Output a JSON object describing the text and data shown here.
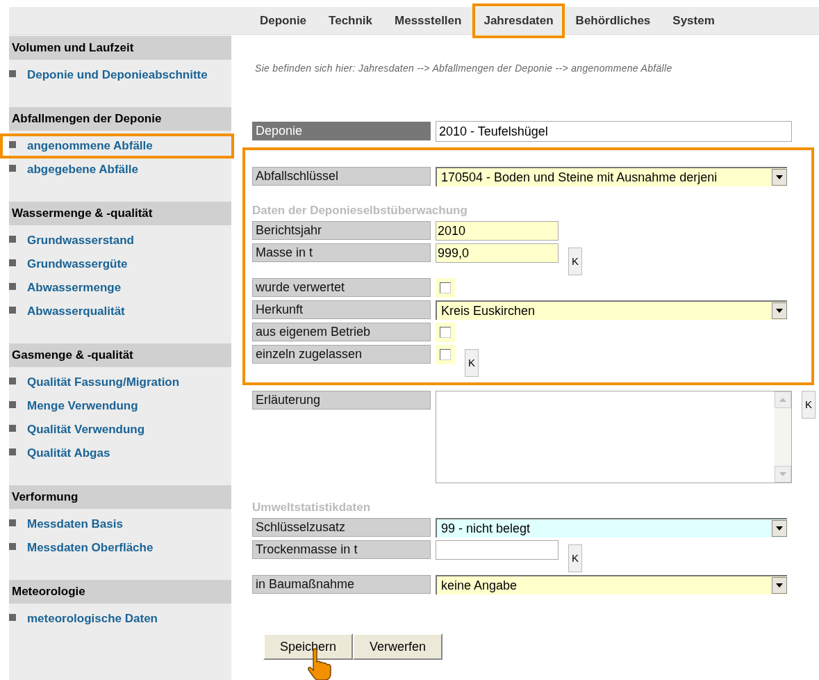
{
  "nav": {
    "tabs": [
      {
        "label": "Deponie",
        "selected": false
      },
      {
        "label": "Technik",
        "selected": false
      },
      {
        "label": "Messstellen",
        "selected": false
      },
      {
        "label": "Jahresdaten",
        "selected": true
      },
      {
        "label": "Behördliches",
        "selected": false
      },
      {
        "label": "System",
        "selected": false
      }
    ]
  },
  "sidebar": {
    "sections": [
      {
        "title": "Volumen und Laufzeit",
        "items": [
          {
            "label": "Deponie und Deponieabschnitte",
            "selected": false
          }
        ]
      },
      {
        "title": "Abfallmengen der Deponie",
        "items": [
          {
            "label": "angenommene Abfälle",
            "selected": true
          },
          {
            "label": "abgegebene Abfälle",
            "selected": false
          }
        ]
      },
      {
        "title": "Wassermenge & -qualität",
        "items": [
          {
            "label": "Grundwasserstand",
            "selected": false
          },
          {
            "label": "Grundwassergüte",
            "selected": false
          },
          {
            "label": "Abwassermenge",
            "selected": false
          },
          {
            "label": "Abwasserqualität",
            "selected": false
          }
        ]
      },
      {
        "title": "Gasmenge & -qualität",
        "items": [
          {
            "label": "Qualität Fassung/Migration",
            "selected": false
          },
          {
            "label": "Menge Verwendung",
            "selected": false
          },
          {
            "label": "Qualität Verwendung",
            "selected": false
          },
          {
            "label": "Qualität Abgas",
            "selected": false
          }
        ]
      },
      {
        "title": "Verformung",
        "items": [
          {
            "label": "Messdaten Basis",
            "selected": false
          },
          {
            "label": "Messdaten Oberfläche",
            "selected": false
          }
        ]
      },
      {
        "title": "Meteorologie",
        "items": [
          {
            "label": "meteorologische Daten",
            "selected": false
          }
        ]
      }
    ]
  },
  "breadcrumb": "Sie befinden sich hier: Jahresdaten --> Abfallmengen der Deponie --> angenommene Abfälle",
  "form": {
    "groups": [
      {
        "highlighted": false,
        "rows": [
          {
            "kind": "readonly",
            "label": "Deponie",
            "value": "2010 - Teufelshügel"
          }
        ]
      },
      {
        "highlighted": true,
        "rows": [
          {
            "kind": "select",
            "label": "Abfallschlüssel",
            "value": "170504 - Boden und Steine mit Ausnahme derjeni",
            "color": "#ffffcc"
          },
          {
            "kind": "heading",
            "label": "Daten der Deponieselbstüberwachung"
          },
          {
            "kind": "text",
            "label": "Berichtsjahr",
            "value": "2010",
            "color": "#ffffcc"
          },
          {
            "kind": "text",
            "label": "Masse in t",
            "value": "999,0",
            "color": "#ffffcc",
            "k_button": "K"
          },
          {
            "kind": "checkbox",
            "label": "wurde verwertet",
            "checked": false
          },
          {
            "kind": "select",
            "label": "Herkunft",
            "value": "Kreis Euskirchen",
            "color": "#ffffcc"
          },
          {
            "kind": "checkbox",
            "label": "aus eigenem Betrieb",
            "checked": false
          },
          {
            "kind": "checkbox",
            "label": "einzeln zugelassen",
            "checked": false,
            "k_button": "K"
          }
        ]
      },
      {
        "highlighted": false,
        "rows": [
          {
            "kind": "textarea",
            "label": "Erläuterung",
            "k_button": "K"
          },
          {
            "kind": "heading",
            "label": "Umweltstatistikdaten"
          },
          {
            "kind": "select",
            "label": "Schlüsselzusatz",
            "value": "99 - nicht belegt",
            "color": "#e0ffff"
          },
          {
            "kind": "text",
            "label": "Trockenmasse in t",
            "value": "",
            "color": "#ffffff",
            "k_button": "K"
          },
          {
            "kind": "select",
            "label": "in Baumaßnahme",
            "value": "keine Angabe",
            "color": "#ffffcc"
          }
        ]
      }
    ]
  },
  "buttons": [
    "Speichern",
    "Verwerfen"
  ]
}
